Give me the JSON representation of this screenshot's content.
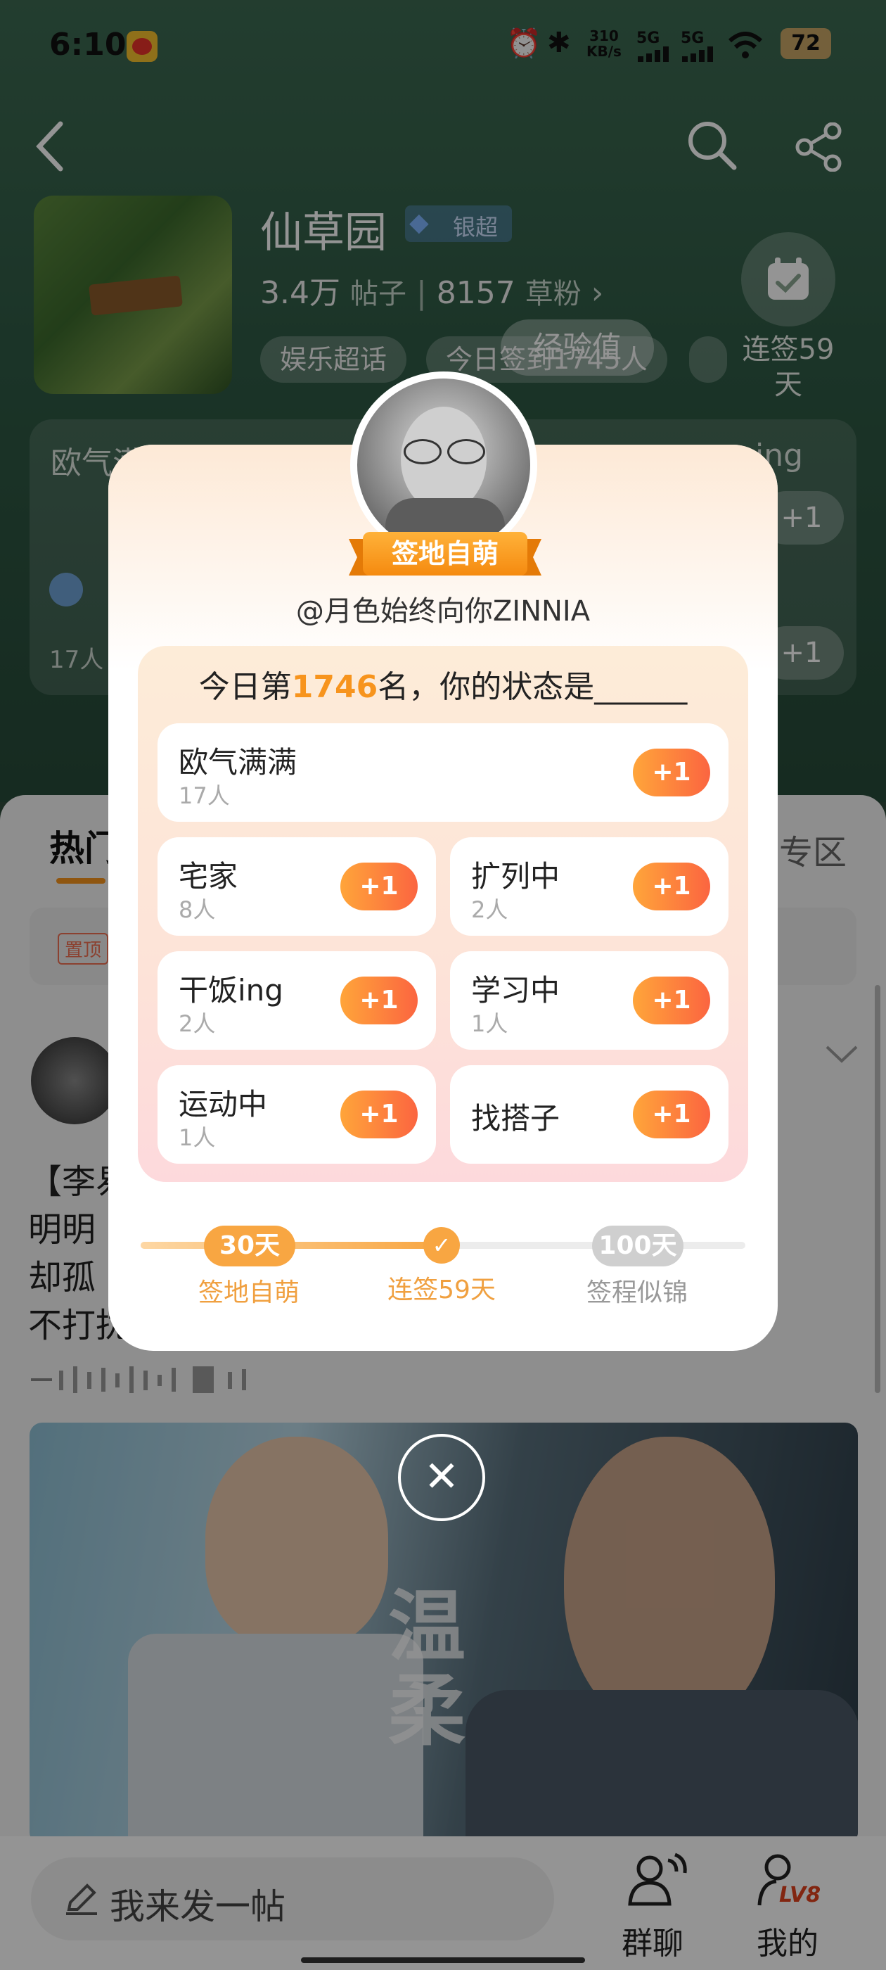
{
  "status_bar": {
    "time": "6:10",
    "speed_top": "310",
    "speed_bottom": "KB/s",
    "net1": "5G",
    "net2": "5G",
    "battery": "72"
  },
  "header": {
    "title": "仙草园",
    "super_badge": "银超",
    "posts_count": "3.4万",
    "posts_label": "帖子",
    "fans_count": "8157",
    "fans_label": "草粉",
    "tags": [
      "娱乐超话",
      "今日签到1745人"
    ],
    "checkin_label_line1": "连签59",
    "checkin_label_line2": "天",
    "exp_toast": "经验值"
  },
  "bg_cards": {
    "left_title": "欧气满满",
    "left_count": "17人",
    "right_title": "ing",
    "plus": "+1"
  },
  "bg_tabs": {
    "hot": "热门",
    "pinned": "置顶",
    "zone": "专区"
  },
  "post": {
    "lines": [
      "【李易",
      "明明",
      "却孤",
      "不打扰"
    ]
  },
  "modal": {
    "ribbon_label": "签地自萌",
    "username": "@月色始终向你ZINNIA",
    "rank_prefix": "今日第",
    "rank_number": "1746",
    "rank_suffix": "名，你的状态是______",
    "options": [
      {
        "name": "欧气满满",
        "count": "17人",
        "plus": "+1"
      },
      {
        "name": "宅家",
        "count": "8人",
        "plus": "+1"
      },
      {
        "name": "扩列中",
        "count": "2人",
        "plus": "+1"
      },
      {
        "name": "干饭ing",
        "count": "2人",
        "plus": "+1"
      },
      {
        "name": "学习中",
        "count": "1人",
        "plus": "+1"
      },
      {
        "name": "运动中",
        "count": "1人",
        "plus": "+1"
      },
      {
        "name": "找搭子",
        "count": "",
        "plus": "+1"
      }
    ],
    "progress": {
      "fraction": 0.5,
      "milestones": [
        {
          "badge": "30天",
          "label": "签地自萌"
        },
        {
          "badge": "",
          "label": "连签59天"
        },
        {
          "badge": "100天",
          "label": "签程似锦"
        }
      ]
    }
  },
  "video": {
    "overlay_text_1": "温",
    "overlay_text_2": "柔"
  },
  "bottom_nav": {
    "post_placeholder": "我来发一帖",
    "group_chat": "群聊",
    "mine": "我的",
    "level": "LV8"
  },
  "colors": {
    "accent_orange": "#f7941d",
    "plus_gradient_start": "#ffa53a",
    "plus_gradient_end": "#fb6540",
    "panel_pink": "#fde3d8"
  }
}
